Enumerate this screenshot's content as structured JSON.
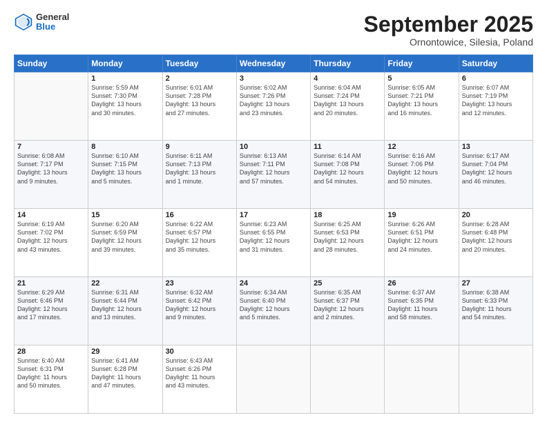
{
  "header": {
    "logo_general": "General",
    "logo_blue": "Blue",
    "month_title": "September 2025",
    "location": "Ornontowice, Silesia, Poland"
  },
  "weekdays": [
    "Sunday",
    "Monday",
    "Tuesday",
    "Wednesday",
    "Thursday",
    "Friday",
    "Saturday"
  ],
  "weeks": [
    [
      {
        "day": "",
        "info": ""
      },
      {
        "day": "1",
        "info": "Sunrise: 5:59 AM\nSunset: 7:30 PM\nDaylight: 13 hours\nand 30 minutes."
      },
      {
        "day": "2",
        "info": "Sunrise: 6:01 AM\nSunset: 7:28 PM\nDaylight: 13 hours\nand 27 minutes."
      },
      {
        "day": "3",
        "info": "Sunrise: 6:02 AM\nSunset: 7:26 PM\nDaylight: 13 hours\nand 23 minutes."
      },
      {
        "day": "4",
        "info": "Sunrise: 6:04 AM\nSunset: 7:24 PM\nDaylight: 13 hours\nand 20 minutes."
      },
      {
        "day": "5",
        "info": "Sunrise: 6:05 AM\nSunset: 7:21 PM\nDaylight: 13 hours\nand 16 minutes."
      },
      {
        "day": "6",
        "info": "Sunrise: 6:07 AM\nSunset: 7:19 PM\nDaylight: 13 hours\nand 12 minutes."
      }
    ],
    [
      {
        "day": "7",
        "info": "Sunrise: 6:08 AM\nSunset: 7:17 PM\nDaylight: 13 hours\nand 9 minutes."
      },
      {
        "day": "8",
        "info": "Sunrise: 6:10 AM\nSunset: 7:15 PM\nDaylight: 13 hours\nand 5 minutes."
      },
      {
        "day": "9",
        "info": "Sunrise: 6:11 AM\nSunset: 7:13 PM\nDaylight: 13 hours\nand 1 minute."
      },
      {
        "day": "10",
        "info": "Sunrise: 6:13 AM\nSunset: 7:11 PM\nDaylight: 12 hours\nand 57 minutes."
      },
      {
        "day": "11",
        "info": "Sunrise: 6:14 AM\nSunset: 7:08 PM\nDaylight: 12 hours\nand 54 minutes."
      },
      {
        "day": "12",
        "info": "Sunrise: 6:16 AM\nSunset: 7:06 PM\nDaylight: 12 hours\nand 50 minutes."
      },
      {
        "day": "13",
        "info": "Sunrise: 6:17 AM\nSunset: 7:04 PM\nDaylight: 12 hours\nand 46 minutes."
      }
    ],
    [
      {
        "day": "14",
        "info": "Sunrise: 6:19 AM\nSunset: 7:02 PM\nDaylight: 12 hours\nand 43 minutes."
      },
      {
        "day": "15",
        "info": "Sunrise: 6:20 AM\nSunset: 6:59 PM\nDaylight: 12 hours\nand 39 minutes."
      },
      {
        "day": "16",
        "info": "Sunrise: 6:22 AM\nSunset: 6:57 PM\nDaylight: 12 hours\nand 35 minutes."
      },
      {
        "day": "17",
        "info": "Sunrise: 6:23 AM\nSunset: 6:55 PM\nDaylight: 12 hours\nand 31 minutes."
      },
      {
        "day": "18",
        "info": "Sunrise: 6:25 AM\nSunset: 6:53 PM\nDaylight: 12 hours\nand 28 minutes."
      },
      {
        "day": "19",
        "info": "Sunrise: 6:26 AM\nSunset: 6:51 PM\nDaylight: 12 hours\nand 24 minutes."
      },
      {
        "day": "20",
        "info": "Sunrise: 6:28 AM\nSunset: 6:48 PM\nDaylight: 12 hours\nand 20 minutes."
      }
    ],
    [
      {
        "day": "21",
        "info": "Sunrise: 6:29 AM\nSunset: 6:46 PM\nDaylight: 12 hours\nand 17 minutes."
      },
      {
        "day": "22",
        "info": "Sunrise: 6:31 AM\nSunset: 6:44 PM\nDaylight: 12 hours\nand 13 minutes."
      },
      {
        "day": "23",
        "info": "Sunrise: 6:32 AM\nSunset: 6:42 PM\nDaylight: 12 hours\nand 9 minutes."
      },
      {
        "day": "24",
        "info": "Sunrise: 6:34 AM\nSunset: 6:40 PM\nDaylight: 12 hours\nand 5 minutes."
      },
      {
        "day": "25",
        "info": "Sunrise: 6:35 AM\nSunset: 6:37 PM\nDaylight: 12 hours\nand 2 minutes."
      },
      {
        "day": "26",
        "info": "Sunrise: 6:37 AM\nSunset: 6:35 PM\nDaylight: 11 hours\nand 58 minutes."
      },
      {
        "day": "27",
        "info": "Sunrise: 6:38 AM\nSunset: 6:33 PM\nDaylight: 11 hours\nand 54 minutes."
      }
    ],
    [
      {
        "day": "28",
        "info": "Sunrise: 6:40 AM\nSunset: 6:31 PM\nDaylight: 11 hours\nand 50 minutes."
      },
      {
        "day": "29",
        "info": "Sunrise: 6:41 AM\nSunset: 6:28 PM\nDaylight: 11 hours\nand 47 minutes."
      },
      {
        "day": "30",
        "info": "Sunrise: 6:43 AM\nSunset: 6:26 PM\nDaylight: 11 hours\nand 43 minutes."
      },
      {
        "day": "",
        "info": ""
      },
      {
        "day": "",
        "info": ""
      },
      {
        "day": "",
        "info": ""
      },
      {
        "day": "",
        "info": ""
      }
    ]
  ]
}
